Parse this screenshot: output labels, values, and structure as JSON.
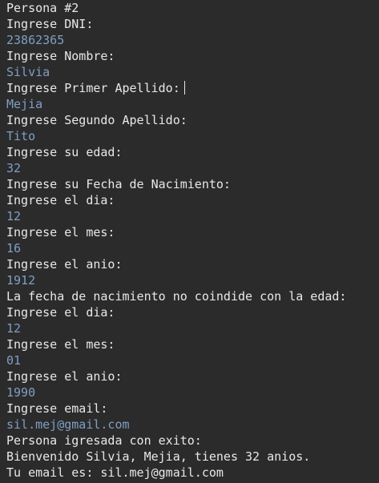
{
  "console": {
    "lines": [
      {
        "text": "Persona #2",
        "kind": "output"
      },
      {
        "text": "Ingrese DNI:",
        "kind": "output"
      },
      {
        "text": "23862365",
        "kind": "input"
      },
      {
        "text": "Ingrese Nombre:",
        "kind": "output"
      },
      {
        "text": "Silvia",
        "kind": "input"
      },
      {
        "text": "Ingrese Primer Apellido:",
        "kind": "output"
      },
      {
        "text": "Mejia",
        "kind": "input"
      },
      {
        "text": "Ingrese Segundo Apellido:",
        "kind": "output"
      },
      {
        "text": "Tito",
        "kind": "input"
      },
      {
        "text": "Ingrese su edad:",
        "kind": "output"
      },
      {
        "text": "32",
        "kind": "input"
      },
      {
        "text": "Ingrese su Fecha de Nacimiento:",
        "kind": "output"
      },
      {
        "text": "Ingrese el dia:",
        "kind": "output"
      },
      {
        "text": "12",
        "kind": "input"
      },
      {
        "text": "Ingrese el mes:",
        "kind": "output"
      },
      {
        "text": "16",
        "kind": "input"
      },
      {
        "text": "Ingrese el anio:",
        "kind": "output"
      },
      {
        "text": "1912",
        "kind": "input"
      },
      {
        "text": "La fecha de nacimiento no coindide con la edad:",
        "kind": "output"
      },
      {
        "text": "Ingrese el dia:",
        "kind": "output"
      },
      {
        "text": "12",
        "kind": "input"
      },
      {
        "text": "Ingrese el mes:",
        "kind": "output"
      },
      {
        "text": "01",
        "kind": "input"
      },
      {
        "text": "Ingrese el anio:",
        "kind": "output"
      },
      {
        "text": "1990",
        "kind": "input"
      },
      {
        "text": "Ingrese email:",
        "kind": "output"
      },
      {
        "text": "sil.mej@gmail.com",
        "kind": "input"
      },
      {
        "text": "Persona igresada con exito:",
        "kind": "output"
      },
      {
        "text": "Bienvenido Silvia, Mejia, tienes 32 anios.",
        "kind": "output"
      },
      {
        "text": "Tu email es: sil.mej@gmail.com",
        "kind": "output"
      }
    ],
    "colors": {
      "background": "#2b2b2b",
      "output_text": "#e8e8e8",
      "input_text": "#7f9fc4"
    }
  }
}
